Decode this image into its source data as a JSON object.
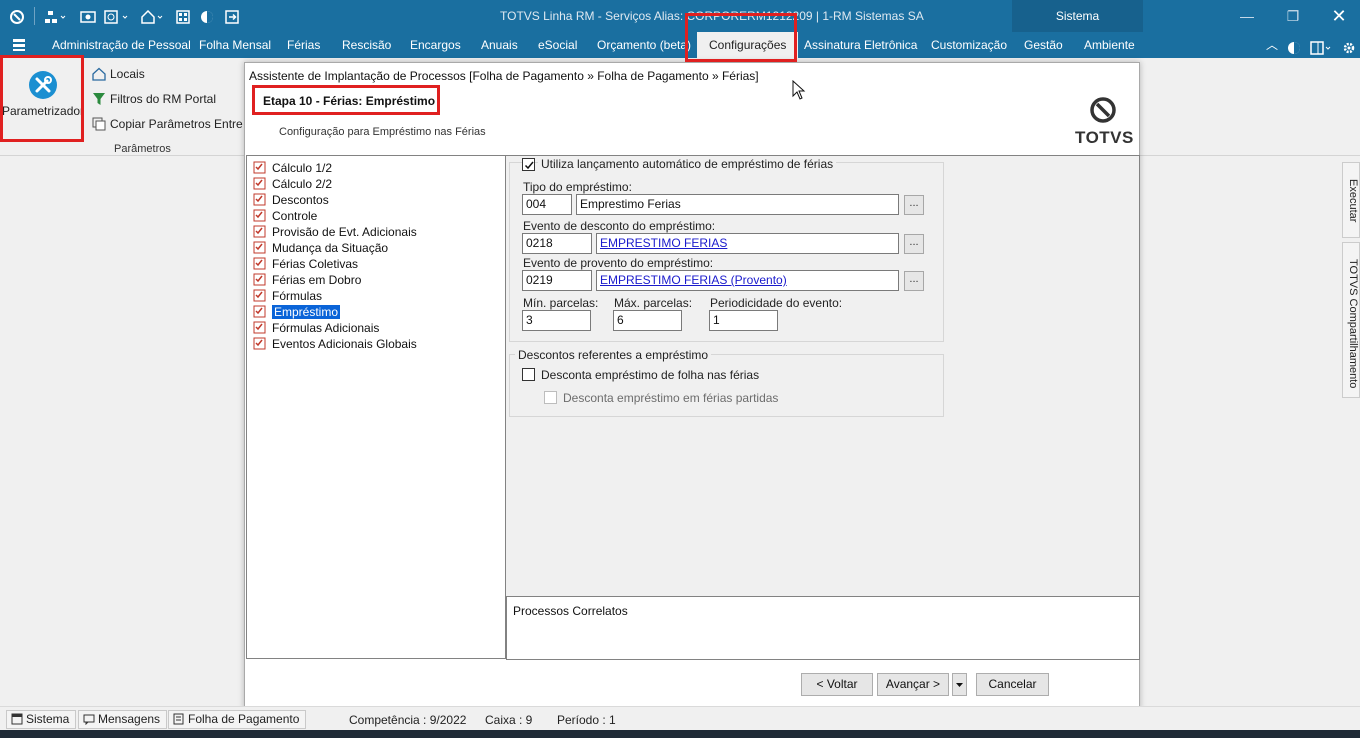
{
  "window": {
    "title": "TOTVS Linha RM - Serviços  Alias: CORPORERM1212209 | 1-RM Sistemas SA",
    "system_tab": "Sistema"
  },
  "ribbon": {
    "tabs": [
      "Administração de Pessoal",
      "Folha Mensal",
      "Férias",
      "Rescisão",
      "Encargos",
      "Anuais",
      "eSocial",
      "Orçamento (beta)",
      "Configurações",
      "Assinatura Eletrônica",
      "Customização",
      "Gestão",
      "Ambiente"
    ],
    "active_tab": "Configurações",
    "parametrizador_label": "Parametrizador",
    "items": [
      "Locais",
      "Filtros do RM Portal",
      "Copiar Parâmetros Entre Co"
    ],
    "group_label": "Parâmetros"
  },
  "dock": {
    "items": [
      "Executar",
      "TOTVS Compartilhamento"
    ]
  },
  "dialog": {
    "title": "Assistente de Implantação de Processos [Folha de Pagamento » Folha de Pagamento » Férias]",
    "step_title": "Etapa 10 - Férias: Empréstimo",
    "step_subtitle": "Configuração para Empréstimo nas Férias",
    "logo_text": "TOTVS",
    "tree": [
      "Cálculo 1/2",
      "Cálculo 2/2",
      "Descontos",
      "Controle",
      "Provisão de Evt. Adicionais",
      "Mudança da Situação",
      "Férias Coletivas",
      "Férias em Dobro",
      "Fórmulas",
      "Empréstimo",
      "Fórmulas Adicionais",
      "Eventos Adicionais Globais"
    ],
    "selected_tree_item": "Empréstimo",
    "auto_loan": {
      "label": "Utiliza lançamento automático de empréstimo de férias",
      "checked": true,
      "tipo_label": "Tipo do empréstimo:",
      "tipo_code": "004",
      "tipo_desc": "Emprestimo Ferias",
      "desconto_label": "Evento de desconto do empréstimo:",
      "desconto_code": "0218",
      "desconto_desc": "EMPRESTIMO FERIAS",
      "provento_label": "Evento de provento do empréstimo:",
      "provento_code": "0219",
      "provento_desc": "EMPRESTIMO FERIAS (Provento)",
      "lookup_label": "...",
      "min_label": "Mín. parcelas:",
      "min_value": "3",
      "max_label": "Máx. parcelas:",
      "max_value": "6",
      "period_label": "Periodicidade do evento:",
      "period_value": "1"
    },
    "descontos": {
      "title": "Descontos referentes a empréstimo",
      "folha_label": "Desconta empréstimo de folha nas férias",
      "folha_checked": false,
      "partidas_label": "Desconta empréstimo em férias partidas",
      "partidas_checked": false
    },
    "related_label": "Processos Correlatos",
    "buttons": {
      "back": "< Voltar",
      "next": "Avançar >",
      "cancel": "Cancelar"
    }
  },
  "statusbar": {
    "tabs": [
      "Sistema",
      "Mensagens",
      "Folha de Pagamento"
    ],
    "competencia": "Competência : 9/2022",
    "caixa": "Caixa : 9",
    "periodo": "Período : 1"
  },
  "colors": {
    "titlebar": "#1a6fa0",
    "highlight_box": "#e02020",
    "selection": "#0a64d8",
    "link": "#1a1acc"
  }
}
